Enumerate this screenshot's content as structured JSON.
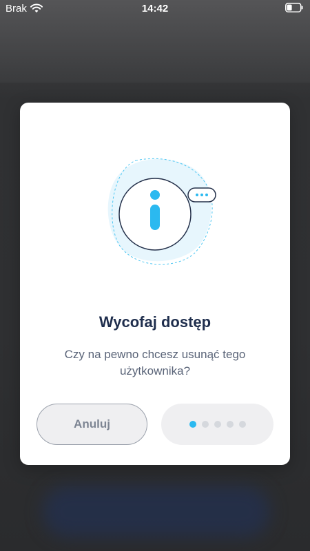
{
  "status_bar": {
    "carrier": "Brak",
    "time": "14:42"
  },
  "modal": {
    "title": "Wycofaj dostęp",
    "message": "Czy na pewno chcesz usunąć tego użytkownika?",
    "cancel_label": "Anuluj",
    "confirm_loading_dots": 5,
    "confirm_active_dot": 1
  },
  "colors": {
    "accent": "#2bb9f0",
    "title": "#1f2e4d",
    "message": "#5a6478",
    "button_bg": "#efeff1"
  },
  "icons": {
    "status_wifi": "wifi-icon",
    "status_battery": "battery-icon",
    "illustration": "info-icon"
  }
}
